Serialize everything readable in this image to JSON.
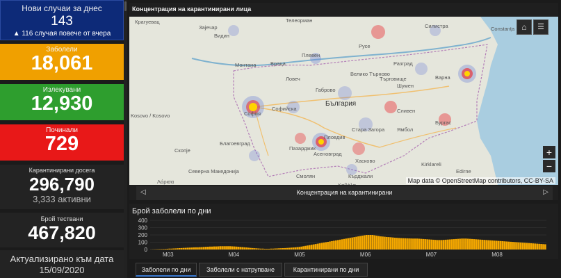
{
  "cards": {
    "new_cases": {
      "label": "Нови случаи за днес",
      "value": "143",
      "sub": "▲ 116 случая повече от вчера"
    },
    "infected": {
      "label": "Заболели",
      "value": "18,061"
    },
    "recovered": {
      "label": "Излекувани",
      "value": "12,930"
    },
    "deaths": {
      "label": "Починали",
      "value": "729"
    },
    "quarantined": {
      "label": "Карантинирани досега",
      "value": "296,790",
      "sub": "3,333 активни"
    },
    "tests": {
      "label": "Брой тествани",
      "value": "467,820"
    },
    "updated": {
      "label": "Актуализирано към дата",
      "date": "15/09/2020"
    }
  },
  "map": {
    "title": "Концентрация на карантинирани лица",
    "attribution": "Map data © OpenStreetMap contributors, CC-BY-SA",
    "nav_label": "Концентрация на карантинирани",
    "zoom_in": "+",
    "zoom_out": "−",
    "country_label": "България",
    "labels": [
      "Крагуевац",
      "Зајечар",
      "Видин",
      "Телеорман",
      "Русе",
      "Силистра",
      "Плевен",
      "Враца",
      "Ловеч",
      "Велико Търново",
      "Разград",
      "Шумен",
      "Варна",
      "Габрово",
      "Търговище",
      "Монтана",
      "София",
      "Софийска",
      "Стара Загора",
      "Сливен",
      "Ямбол",
      "Бургас",
      "Пазарджик",
      "Пловдив",
      "Асеновград",
      "Хасково",
      "Кърджали",
      "Смолян",
      "Благоевград",
      "Скопје",
      "Kosovo / Kosovo",
      "Северна Македонија",
      "Kirklareli",
      "Edirne",
      "Constanța",
      "Λάρισα",
      "Καβάλα"
    ],
    "colors": {
      "land": "#e7e8de",
      "water": "#a9cde0",
      "hot": "#ffd400",
      "warm": "#e8383c",
      "cool": "#6b7fd6"
    }
  },
  "chart": {
    "title": "Брой заболели по дни",
    "tabs": [
      "Заболели по дни",
      "Заболели с натрупване",
      "Карантинирани по дни"
    ]
  },
  "chart_data": {
    "type": "bar",
    "x_ticks": [
      "M03",
      "M04",
      "M05",
      "M06",
      "M07",
      "M08"
    ],
    "y_ticks": [
      0,
      100,
      200,
      300,
      400
    ],
    "ylim": [
      0,
      400
    ],
    "bar_color": "#f5a800",
    "values": [
      1,
      2,
      3,
      4,
      5,
      6,
      7,
      8,
      10,
      12,
      12,
      14,
      15,
      17,
      19,
      20,
      22,
      23,
      25,
      26,
      27,
      29,
      30,
      30,
      32,
      33,
      35,
      37,
      38,
      40,
      40,
      42,
      42,
      43,
      45,
      45,
      45,
      45,
      45,
      45,
      43,
      42,
      40,
      38,
      35,
      33,
      30,
      28,
      25,
      22,
      20,
      18,
      16,
      14,
      12,
      12,
      10,
      10,
      10,
      12,
      12,
      14,
      15,
      17,
      18,
      19,
      20,
      22,
      24,
      26,
      28,
      30,
      33,
      36,
      40,
      45,
      50,
      55,
      60,
      65,
      70,
      75,
      80,
      85,
      90,
      95,
      100,
      105,
      110,
      115,
      120,
      125,
      130,
      135,
      140,
      145,
      150,
      155,
      160,
      165,
      170,
      175,
      180,
      185,
      190,
      195,
      200,
      200,
      200,
      200,
      195,
      190,
      185,
      180,
      178,
      175,
      172,
      170,
      168,
      165,
      162,
      160,
      158,
      156,
      155,
      154,
      153,
      152,
      151,
      150,
      150,
      150,
      148,
      146,
      144,
      142,
      140,
      138,
      136,
      134,
      132,
      130,
      130,
      130,
      132,
      134,
      136,
      138,
      140,
      142,
      144,
      146,
      148,
      150,
      150,
      150,
      148,
      146,
      144,
      142,
      140,
      138,
      136,
      134,
      132,
      130,
      128,
      126,
      124,
      122,
      120,
      118,
      116,
      114,
      112,
      110,
      108,
      106,
      104,
      102,
      100,
      98,
      96,
      94,
      92,
      90,
      88,
      86,
      84,
      82,
      80,
      78,
      76,
      74,
      72
    ]
  }
}
